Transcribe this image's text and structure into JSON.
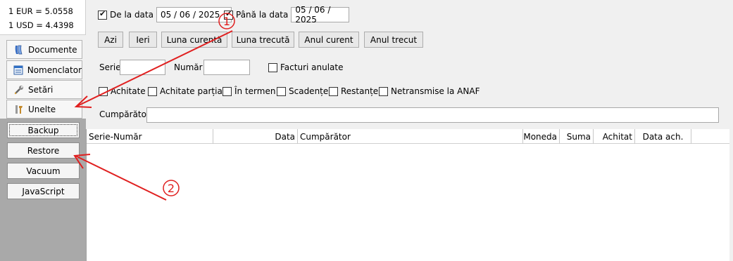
{
  "rates": {
    "eur": "1 EUR = 5.0558",
    "usd": "1 USD = 4.4398"
  },
  "sidebar": {
    "items": [
      {
        "label": "Documente",
        "icon": "documents-icon"
      },
      {
        "label": "Nomenclator",
        "icon": "list-icon"
      },
      {
        "label": "Setări",
        "icon": "wrench-icon"
      },
      {
        "label": "Unelte",
        "icon": "tools-icon"
      }
    ],
    "tools": [
      "Backup",
      "Restore",
      "Vacuum",
      "JavaScript"
    ]
  },
  "filters": {
    "from_label": "De la data",
    "from_value": "05 / 06 / 2025",
    "to_label": "Până la data",
    "to_value": "05 / 06 / 2025",
    "quick": [
      "Azi",
      "Ieri",
      "Luna curentă",
      "Luna trecută",
      "Anul curent",
      "Anul trecut"
    ],
    "serie_label": "Serie",
    "numar_label": "Număr",
    "anulate_label": "Facturi anulate",
    "status": [
      "Achitate",
      "Achitate parțial",
      "În termen",
      "Scadențe",
      "Restanțe",
      "Netransmise la ANAF"
    ],
    "buyer_label": "Cumpărător"
  },
  "table": {
    "columns": [
      "Serie-Număr",
      "Data",
      "Cumpărător",
      "Moneda",
      "Suma",
      "Achitat",
      "Data ach."
    ]
  },
  "annotations": {
    "one": "1",
    "two": "2",
    "color": "#e02020"
  }
}
